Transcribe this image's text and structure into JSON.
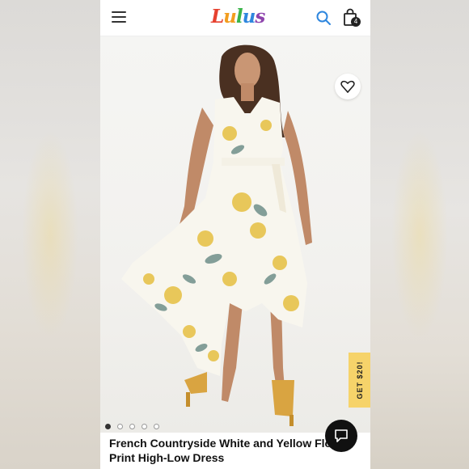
{
  "header": {
    "logo_letters": [
      "L",
      "u",
      "l",
      "u",
      "s"
    ],
    "bag_count": "4",
    "icons": {
      "menu": "menu-icon",
      "search": "search-icon",
      "bag": "shopping-bag-icon"
    }
  },
  "product": {
    "title": "French Countryside White and Yellow Floral Print High-Low Dress"
  },
  "promo": {
    "label": "GET $20!"
  },
  "gallery": {
    "dots": 5,
    "active_index": 0
  },
  "colors": {
    "promo_bg": "#f6d36a",
    "chat_bg": "#111111",
    "accent_blue": "#2e86de"
  }
}
